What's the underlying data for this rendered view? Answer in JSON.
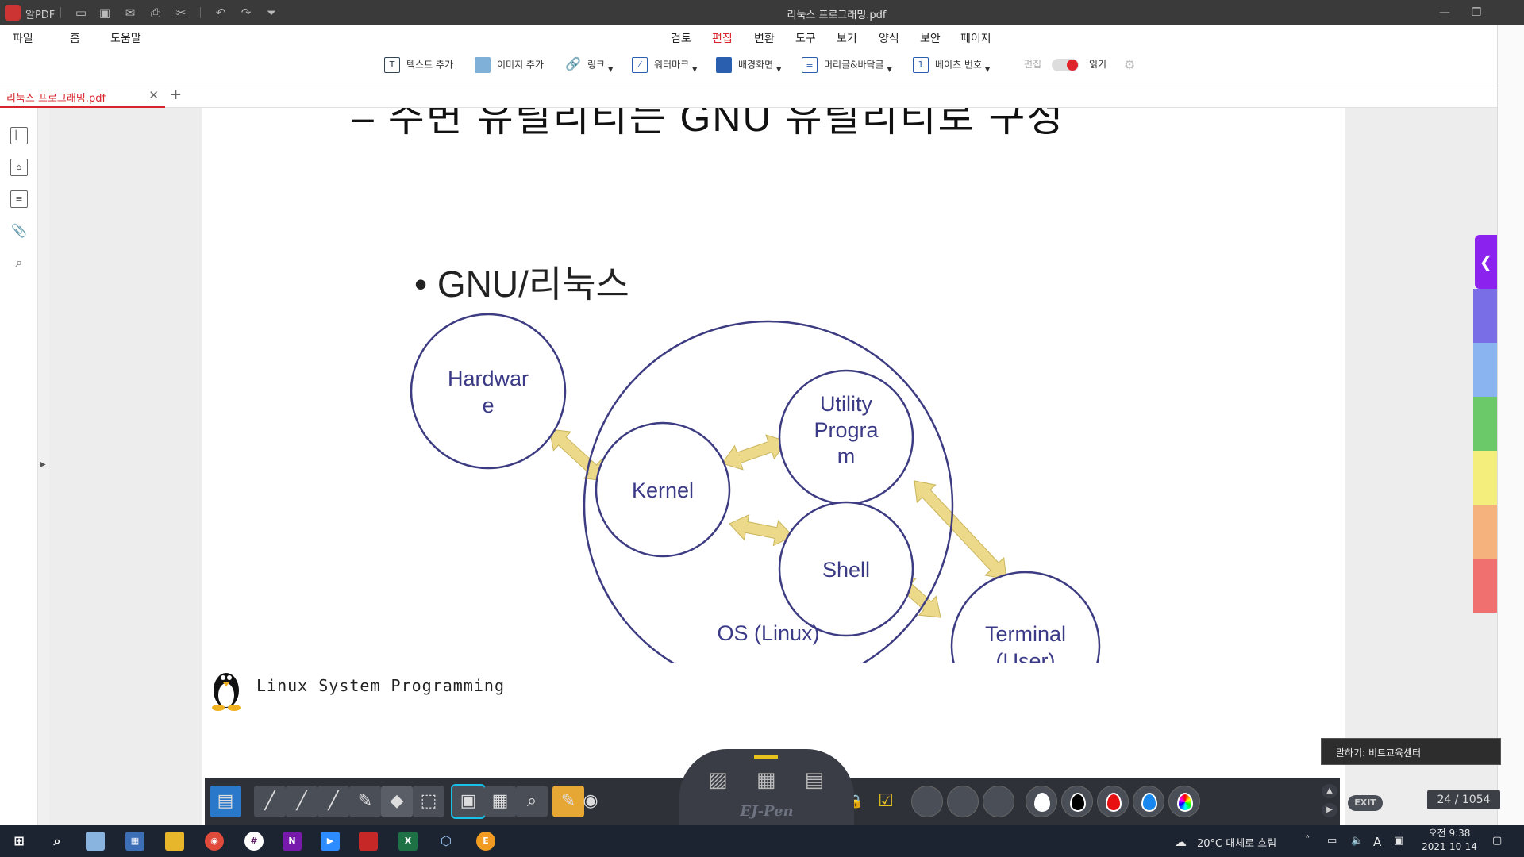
{
  "titlebar": {
    "app_name": "알PDF",
    "document_title": "리눅스 프로그래밍.pdf",
    "minimize_glyph": "—",
    "restore_glyph": "❐"
  },
  "menu": {
    "file": "파일",
    "home": "홈",
    "help": "도움말"
  },
  "ribbon_tabs": [
    "검토",
    "편집",
    "변환",
    "도구",
    "보기",
    "양식",
    "보안",
    "페이지"
  ],
  "active_tab": "편집",
  "toolbar": {
    "add_text": "텍스트 추가",
    "add_image": "이미지 추가",
    "link": "링크",
    "watermark": "워터마크",
    "background": "배경화면",
    "header_footer": "머리글&바닥글",
    "bates_number": "베이츠 번호",
    "edit_mode": "편집",
    "read_mode": "읽기"
  },
  "doc_tab": {
    "name": "리눅스 프로그래밍.pdf"
  },
  "page": {
    "cutoff_title": "– 주변 유틸리티는 GNU 유틸리티로 구성",
    "bullet": "GNU/리눅스",
    "page_number": "24",
    "diagram": {
      "hardware": [
        "Hardwar",
        "e"
      ],
      "kernel": "Kernel",
      "utility": [
        "Utility",
        "Progra",
        "m"
      ],
      "shell": "Shell",
      "os": "OS (Linux)",
      "terminal": [
        "Terminal",
        "(User)"
      ],
      "circle_color": "#3d3c82",
      "arrow_color": "#ecd98a"
    }
  },
  "next_page": {
    "header": "Linux System Programming"
  },
  "side_panel_colors": [
    "#8b22ee",
    "#7a6ee6",
    "#8ab4f0",
    "#6cc96a",
    "#f4ee7c",
    "#f5b27c",
    "#f07070"
  ],
  "pen_toolbar": {
    "label": "EJ-Pen",
    "exit": "EXIT"
  },
  "tooltip": "말하기: 비트교육센터",
  "page_counter": "24 / 1054",
  "taskbar": {
    "weather": "20°C 대체로 흐림",
    "ime": "A",
    "time": "오전 9:38",
    "date": "2021-10-14"
  }
}
